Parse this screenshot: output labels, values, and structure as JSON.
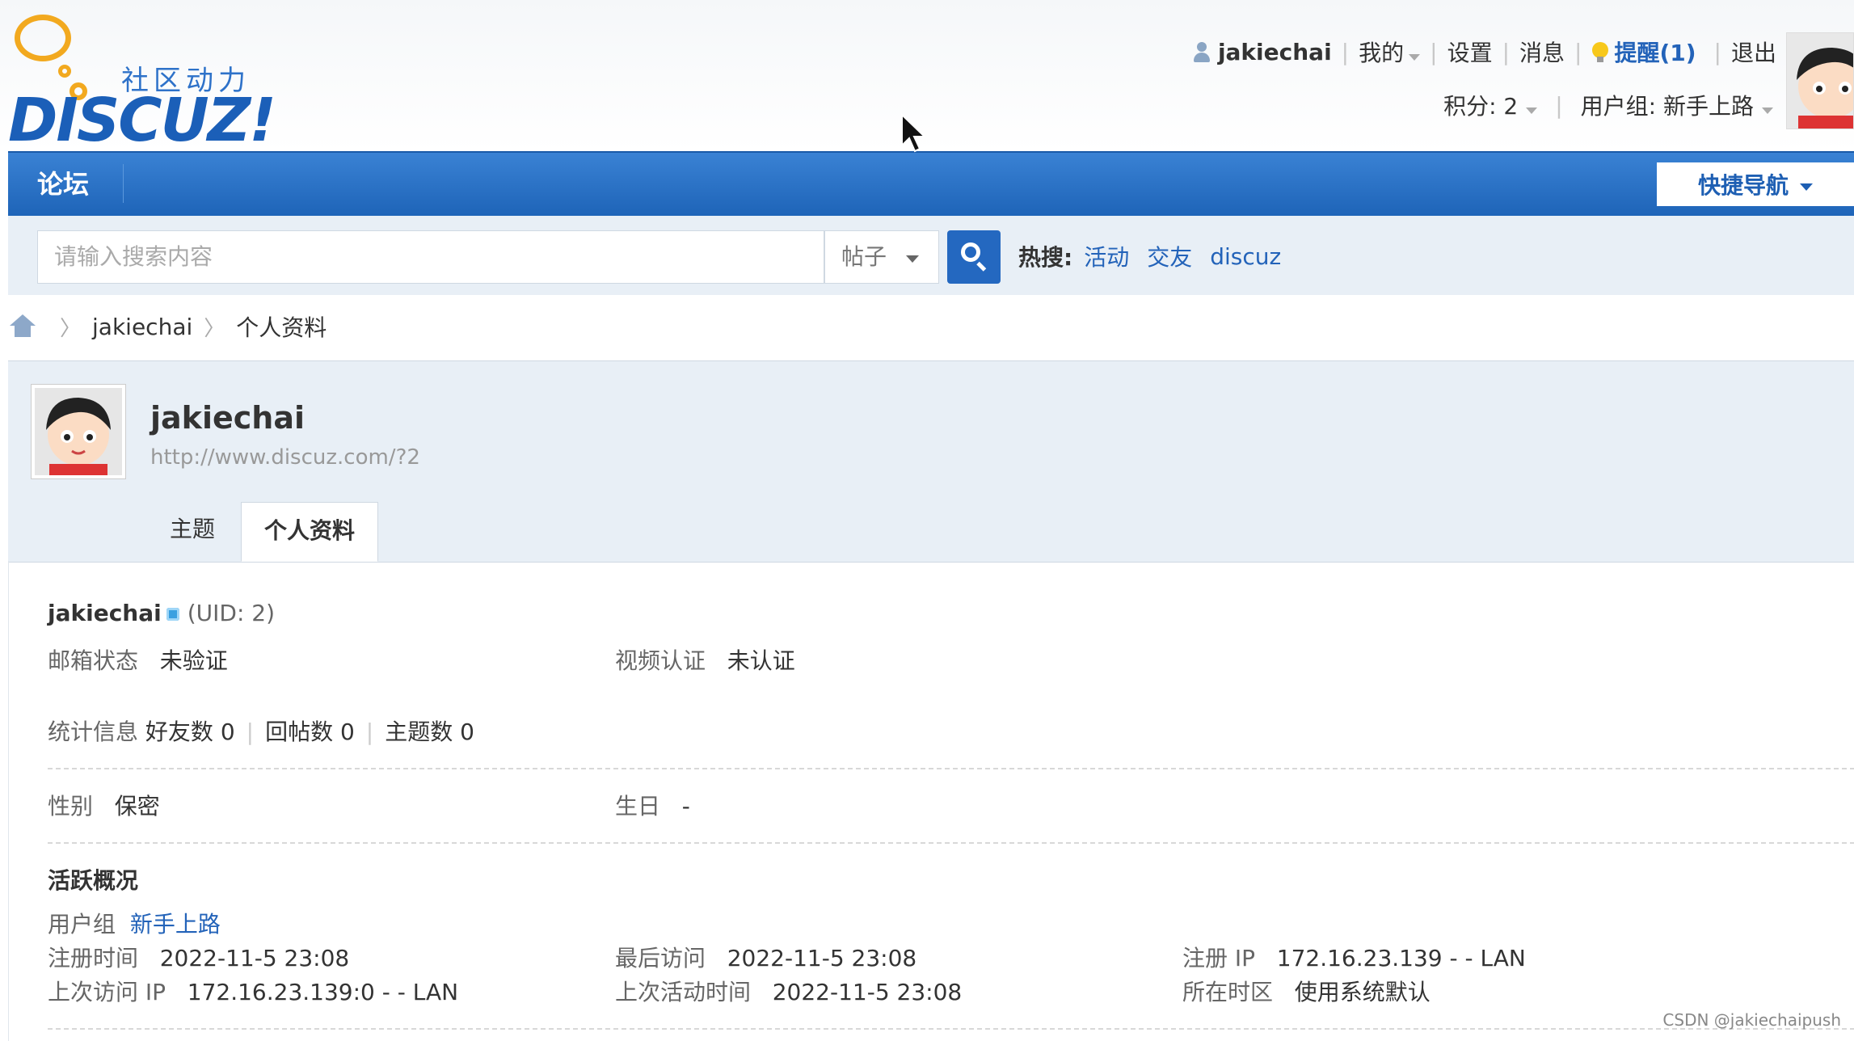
{
  "logo": {
    "slogan": "社区动力",
    "brand": "DISCUZ!"
  },
  "userbar": {
    "username": "jakiechai",
    "mine": "我的",
    "settings": "设置",
    "messages": "消息",
    "remind": "提醒(1)",
    "logout": "退出",
    "points": "积分: 2",
    "usergroup": "用户组: 新手上路"
  },
  "nav": {
    "forum": "论坛",
    "quicknav": "快捷导航"
  },
  "search": {
    "placeholder": "请输入搜索内容",
    "type": "帖子",
    "hot_label": "热搜:",
    "hot": [
      "活动",
      "交友",
      "discuz"
    ]
  },
  "breadcrumb": {
    "user": "jakiechai",
    "page": "个人资料"
  },
  "profile": {
    "name": "jakiechai",
    "url": "http://www.discuz.com/?2",
    "tabs": [
      "主题",
      "个人资料"
    ]
  },
  "details": {
    "username": "jakiechai",
    "uid": "(UID: 2)",
    "email_label": "邮箱状态",
    "email_value": "未验证",
    "video_label": "视频认证",
    "video_value": "未认证",
    "stats_label": "统计信息",
    "friends": "好友数 0",
    "replies": "回帖数 0",
    "threads": "主题数 0",
    "gender_label": "性别",
    "gender_value": "保密",
    "birthday_label": "生日",
    "birthday_value": "-",
    "activity_title": "活跃概况",
    "group_label": "用户组",
    "group_value": "新手上路",
    "reg_time_label": "注册时间",
    "reg_time_value": "2022-11-5 23:08",
    "last_visit_label": "最后访问",
    "last_visit_value": "2022-11-5 23:08",
    "reg_ip_label": "注册 IP",
    "reg_ip_value": "172.16.23.139 - - LAN",
    "last_ip_label": "上次访问 IP",
    "last_ip_value": "172.16.23.139:0 - - LAN",
    "last_active_label": "上次活动时间",
    "last_active_value": "2022-11-5 23:08",
    "timezone_label": "所在时区",
    "timezone_value": "使用系统默认"
  },
  "watermark": "CSDN @jakiechaipush"
}
